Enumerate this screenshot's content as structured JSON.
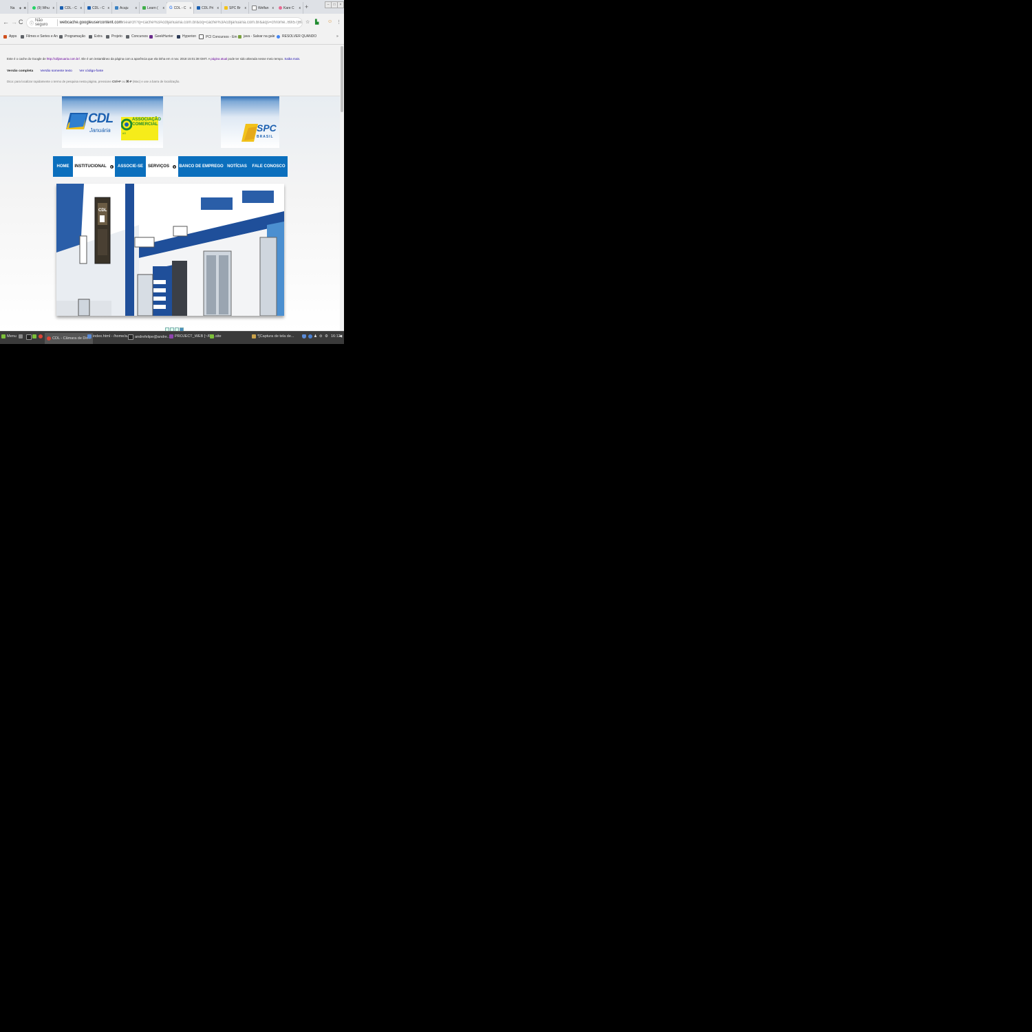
{
  "browser": {
    "tabs": [
      {
        "label": "Na",
        "favicon_color": "#e62117"
      },
      {
        "label": "",
        "favicon_color": "#555555"
      },
      {
        "label": "(9) Whu",
        "favicon_color": "#25d366"
      },
      {
        "label": "CDL - C",
        "favicon_color": "#1a5fb0"
      },
      {
        "label": "CDL - C",
        "favicon_color": "#1a5fb0"
      },
      {
        "label": "Acaju",
        "favicon_color": "#3b82c4"
      },
      {
        "label": "Learn (",
        "favicon_color": "#3fae49"
      },
      {
        "label": "CDL - C",
        "favicon_color": "#4285f4"
      },
      {
        "label": "CDL Pri",
        "favicon_color": "#1a5fb0"
      },
      {
        "label": "SPC Br",
        "favicon_color": "#f2c21a"
      },
      {
        "label": "Welfan",
        "favicon_color": "#777777"
      },
      {
        "label": "Kare C",
        "favicon_color": "#e86a92"
      }
    ],
    "active_tab_index": 7,
    "new_tab": "+",
    "address": {
      "security": "Não seguro",
      "host": "webcache.googleusercontent.com",
      "path": "/search?q=cache%3Acdljanuaria.com.br&oq=cache%3Acdljanuaria.com.br&aqs=chrome..69i57j69i58.3177j..."
    },
    "bookmarks": [
      {
        "label": "Apps",
        "icon": "apps-grid-icon"
      },
      {
        "label": "Filmes e Series e An",
        "icon": "folder-icon"
      },
      {
        "label": "Programação",
        "icon": "folder-icon"
      },
      {
        "label": "Extra",
        "icon": "folder-icon"
      },
      {
        "label": "Projeto",
        "icon": "folder-icon"
      },
      {
        "label": "Concursos",
        "icon": "folder-icon"
      },
      {
        "label": "GeekHunter",
        "icon": "geekhunter-icon"
      },
      {
        "label": "Hyperion",
        "icon": "hyperion-icon"
      },
      {
        "label": "PCI Concursos - Em",
        "icon": "pci-icon"
      },
      {
        "label": "java - Salvar na gale",
        "icon": "stack-icon"
      },
      {
        "label": "RESOLVER QUANDO",
        "icon": "chrome-icon"
      }
    ],
    "bookmarks_overflow": "»"
  },
  "cache_notice": {
    "text_before_link": "Este é o cache do Google de ",
    "cached_url": "http://cdljanuaria.com.br/",
    "text_middle": ". Ele é um instantâneo da página com a aparência que ela tinha em 4 nov. 2018 15:01:38 GMT. A ",
    "current_page_link": "página atual",
    "text_after": " pode ter sido alterada nesse meio tempo. ",
    "learn_more": "Saiba mais.",
    "versions": {
      "full": "Versão completa",
      "text_only": "Versão somente texto",
      "source": "Ver código-fonte"
    },
    "tip_before": "Dica: para localizar rapidamente o termo de pesquisa nesta página, pressione ",
    "tip_key1": "Ctrl+F",
    "tip_mid": " ou ",
    "tip_key2": "⌘-F",
    "tip_after": " (Mac) e use a barra de localização."
  },
  "site": {
    "logo_cdl": "CDL",
    "logo_cdl_city": "Januária",
    "logo_aci_line1": "ASSOCIAÇÃO",
    "logo_aci_line2": "COMERCIAL",
    "logo_aci_abbr": "ACI",
    "logo_spc": "SPC",
    "logo_spc_sub": "BRASIL",
    "nav": [
      {
        "label": "HOME",
        "dropdown": false
      },
      {
        "label": "INSTITUCIONAL",
        "dropdown": true
      },
      {
        "label": "ASSOCIE-SE",
        "dropdown": false
      },
      {
        "label": "SERVIÇOS",
        "dropdown": true
      },
      {
        "label": "BANCO DE EMPREGO",
        "dropdown": false
      },
      {
        "label": "NOTÍCIAS",
        "dropdown": false
      },
      {
        "label": "FALE CONOSCO",
        "dropdown": false
      }
    ],
    "hero_sign": "CDL",
    "slider_count": 4,
    "slider_active": 4
  },
  "taskbar": {
    "menu": "Menu",
    "windows": [
      {
        "label": "CDL - Câmara de Dir..."
      },
      {
        "label": "index.html - /home/a..."
      },
      {
        "label": "andrefelipe@andre..."
      },
      {
        "label": "PROJECT_WEB [~/Pr..."
      },
      {
        "label": "site"
      },
      {
        "label": "*[Captura de tela de..."
      }
    ],
    "clock": "16:12"
  }
}
